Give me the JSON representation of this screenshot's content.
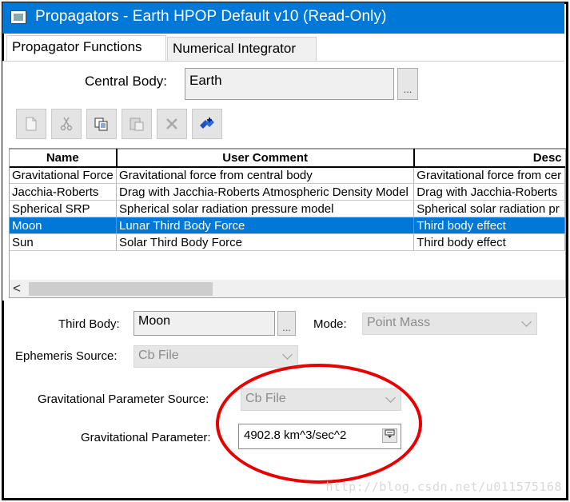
{
  "window": {
    "title": "Propagators - Earth HPOP Default v10 (Read-Only)",
    "icon": "window-icon"
  },
  "tabs": [
    {
      "label": "Propagator Functions",
      "active": true
    },
    {
      "label": "Numerical Integrator",
      "active": false
    }
  ],
  "central_body": {
    "label": "Central Body:",
    "value": "Earth",
    "browse": "..."
  },
  "toolbar": {
    "buttons": [
      {
        "icon": "new-icon",
        "enabled": false
      },
      {
        "icon": "cut-icon",
        "enabled": false
      },
      {
        "icon": "copy-icon",
        "enabled": true
      },
      {
        "icon": "paste-icon",
        "enabled": false
      },
      {
        "icon": "delete-icon",
        "enabled": false
      },
      {
        "icon": "add-components-icon",
        "enabled": true
      }
    ]
  },
  "grid": {
    "columns": [
      "Name",
      "User Comment",
      "Desc"
    ],
    "rows": [
      {
        "name": "Gravitational Force",
        "comment": "Gravitational force from central body",
        "desc": "Gravitational force from cer"
      },
      {
        "name": "Jacchia-Roberts",
        "comment": "Drag with Jacchia-Roberts Atmospheric Density Model",
        "desc": "Drag with Jacchia-Roberts"
      },
      {
        "name": "Spherical SRP",
        "comment": "Spherical solar radiation pressure model",
        "desc": "Spherical solar radiation pr"
      },
      {
        "name": "Moon",
        "comment": "Lunar Third Body Force",
        "desc": "Third body effect"
      },
      {
        "name": "Sun",
        "comment": "Solar Third Body Force",
        "desc": "Third body effect"
      }
    ],
    "selected_row": "Moon",
    "scroll_left": "<"
  },
  "third_body": {
    "label": "Third Body:",
    "value": "Moon",
    "browse": "..."
  },
  "mode": {
    "label": "Mode:",
    "value": "Point Mass"
  },
  "ephemeris_source": {
    "label": "Ephemeris Source:",
    "value": "Cb File"
  },
  "grav_param_source": {
    "label": "Gravitational Parameter Source:",
    "value": "Cb File"
  },
  "grav_param": {
    "label": "Gravitational Parameter:",
    "value": "4902.8 km^3/sec^2",
    "units_button_icon": "units-icon"
  },
  "colors": {
    "title_bar": "#0078d7",
    "selection": "#0078d7",
    "annotation": "#e60000"
  },
  "watermark": "http://blog.csdn.net/u011575168"
}
